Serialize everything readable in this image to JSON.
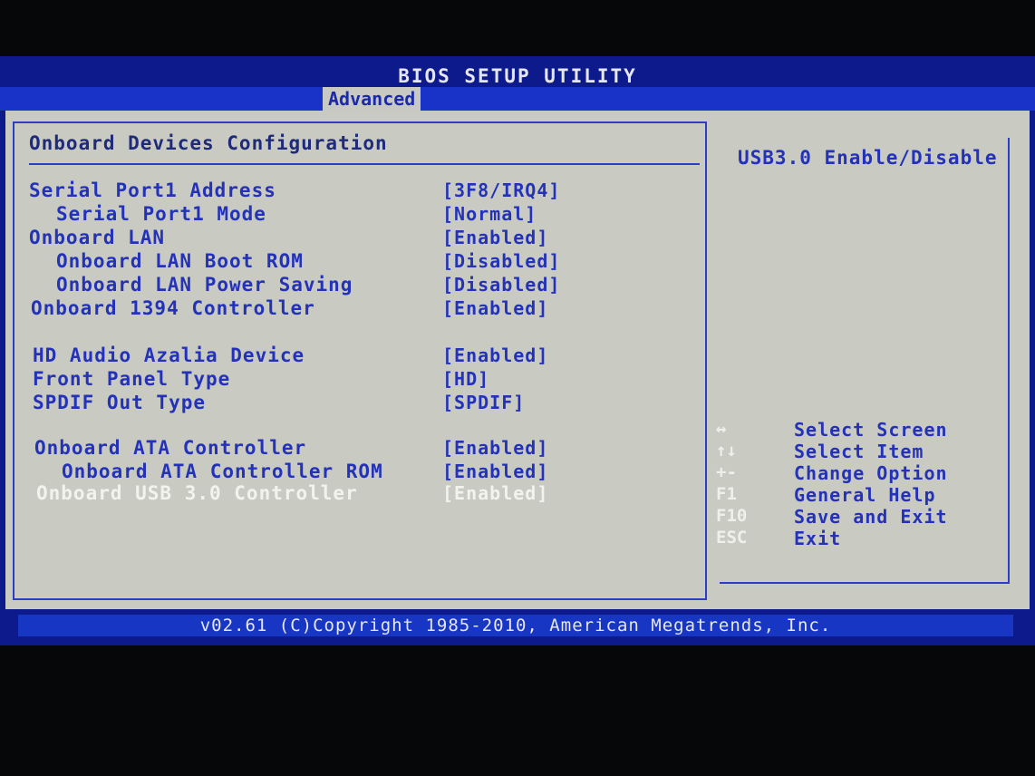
{
  "title": "BIOS SETUP UTILITY",
  "active_tab": "Advanced",
  "section_title": "Onboard Devices Configuration",
  "settings": [
    {
      "label": "Serial Port1 Address",
      "value": "[3F8/IRQ4]"
    },
    {
      "label": "Serial Port1 Mode",
      "value": "[Normal]"
    },
    {
      "label": "Onboard LAN",
      "value": "[Enabled]"
    },
    {
      "label": "Onboard LAN Boot ROM",
      "value": "[Disabled]"
    },
    {
      "label": "Onboard LAN Power Saving",
      "value": "[Disabled]"
    },
    {
      "label": "Onboard 1394 Controller",
      "value": "[Enabled]"
    },
    {
      "label": "HD Audio Azalia Device",
      "value": "[Enabled]"
    },
    {
      "label": "Front Panel Type",
      "value": "[HD]"
    },
    {
      "label": "SPDIF Out Type",
      "value": "[SPDIF]"
    },
    {
      "label": "Onboard ATA Controller",
      "value": "[Enabled]"
    },
    {
      "label": "Onboard ATA Controller ROM",
      "value": "[Enabled]"
    },
    {
      "label": "Onboard USB 3.0 Controller",
      "value": "[Enabled]"
    }
  ],
  "selected_setting": "Onboard USB 3.0 Controller",
  "help_text": "USB3.0 Enable/Disable",
  "keys": [
    {
      "key": "↔",
      "desc": "Select Screen"
    },
    {
      "key": "↑↓",
      "desc": "Select Item"
    },
    {
      "key": "+-",
      "desc": "Change Option"
    },
    {
      "key": "F1",
      "desc": "General Help"
    },
    {
      "key": "F10",
      "desc": "Save and Exit"
    },
    {
      "key": "ESC",
      "desc": "Exit"
    }
  ],
  "footer": "v02.61 (C)Copyright 1985-2010, American Megatrends, Inc.",
  "colors": {
    "background": "#0c1a8c",
    "panel": "#c9cbc3",
    "text": "#2332b8",
    "highlight": "#f3f3ee"
  }
}
